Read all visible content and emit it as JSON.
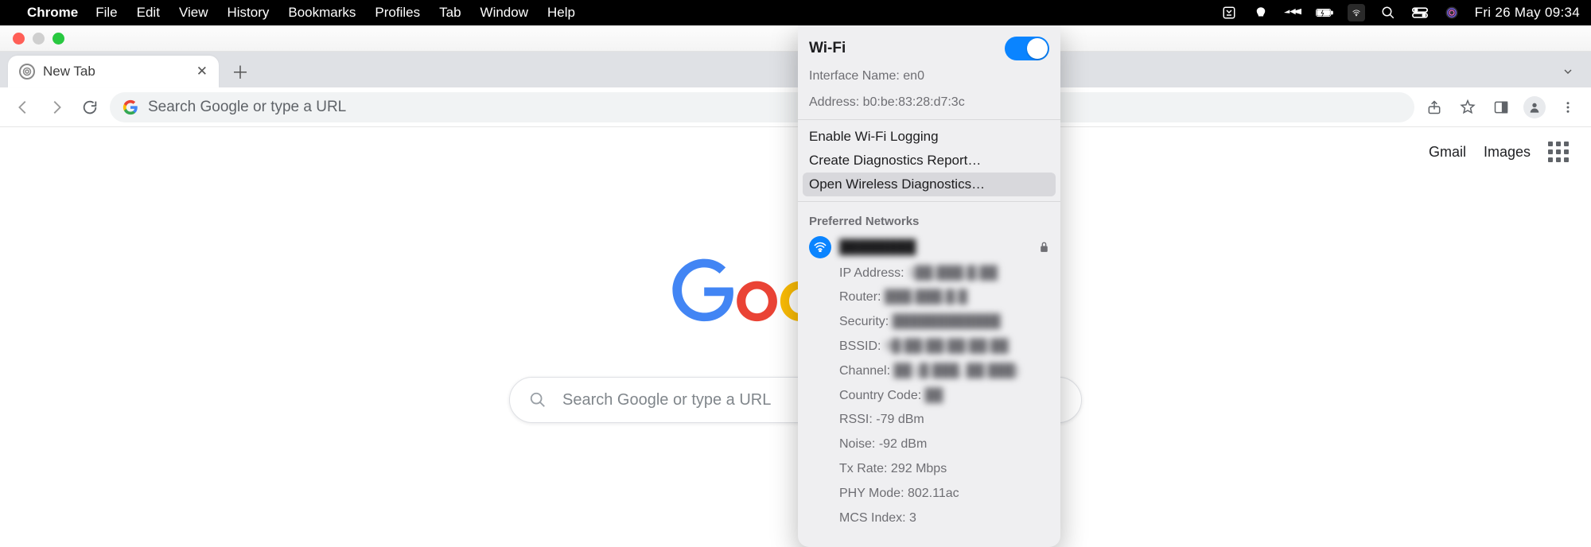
{
  "menubar": {
    "app": "Chrome",
    "items": [
      "File",
      "Edit",
      "View",
      "History",
      "Bookmarks",
      "Profiles",
      "Tab",
      "Window",
      "Help"
    ],
    "clock": "Fri 26 May  09:34"
  },
  "tabstrip": {
    "tab_title": "New Tab"
  },
  "toolbar": {
    "omnibox_placeholder": "Search Google or type a URL"
  },
  "content": {
    "link_gmail": "Gmail",
    "link_images": "Images",
    "search_placeholder": "Search Google or type a URL"
  },
  "wifi": {
    "title": "Wi-Fi",
    "interface_label": "Interface Name:",
    "interface_value": "en0",
    "address_label": "Address:",
    "address_value": "b0:be:83:28:d7:3c",
    "action_logging": "Enable Wi-Fi Logging",
    "action_report": "Create Diagnostics Report…",
    "action_diag": "Open Wireless Diagnostics…",
    "section_preferred": "Preferred Networks",
    "network_name": "████████",
    "details": {
      "ip_label": "IP Address:",
      "ip_value": "1██.███.█.██",
      "router_label": "Router:",
      "router_value": "███.███.█.█",
      "security_label": "Security:",
      "security_value": "████████████",
      "bssid_label": "BSSID:",
      "bssid_value": "9█:██:██:██:██:██",
      "channel_label": "Channel:",
      "channel_value": "██ (█ ███, ██ ███)",
      "country_label": "Country Code:",
      "country_value": "██",
      "rssi_label": "RSSI:",
      "rssi_value": "-79 dBm",
      "noise_label": "Noise:",
      "noise_value": "-92 dBm",
      "txrate_label": "Tx Rate:",
      "txrate_value": "292 Mbps",
      "phy_label": "PHY Mode:",
      "phy_value": "802.11ac",
      "mcs_label": "MCS Index:",
      "mcs_value": "3"
    }
  }
}
